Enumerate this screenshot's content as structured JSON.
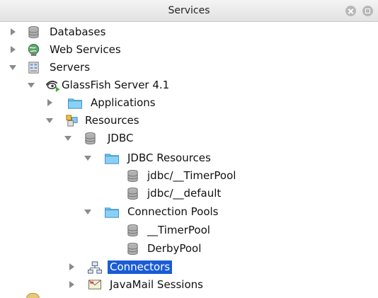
{
  "window": {
    "title": "Services"
  },
  "tree": [
    {
      "label": "Databases",
      "expanded": false,
      "icon": "database-icon"
    },
    {
      "label": "Web Services",
      "expanded": false,
      "icon": "web-services-icon"
    },
    {
      "label": "Servers",
      "expanded": true,
      "icon": "servers-icon"
    },
    {
      "label": "GlassFish Server 4.1",
      "expanded": true,
      "icon": "glassfish-server-icon"
    },
    {
      "label": "Applications",
      "expanded": false,
      "icon": "folder-icon"
    },
    {
      "label": "Resources",
      "expanded": true,
      "icon": "resources-icon"
    },
    {
      "label": "JDBC",
      "expanded": true,
      "icon": "database-icon"
    },
    {
      "label": "JDBC Resources",
      "expanded": true,
      "icon": "folder-icon"
    },
    {
      "label": "jdbc/__TimerPool",
      "icon": "jdbc-resource-icon"
    },
    {
      "label": "jdbc/__default",
      "icon": "jdbc-resource-icon"
    },
    {
      "label": "Connection Pools",
      "expanded": true,
      "icon": "folder-icon"
    },
    {
      "label": "__TimerPool",
      "icon": "connection-pool-icon"
    },
    {
      "label": "DerbyPool",
      "icon": "connection-pool-icon"
    },
    {
      "label": "Connectors",
      "expanded": false,
      "selected": true,
      "icon": "connectors-icon"
    },
    {
      "label": "JavaMail Sessions",
      "expanded": false,
      "icon": "javamail-icon"
    }
  ],
  "colors": {
    "selection": "#1a5cd6",
    "folder": "#6cc0f0",
    "database": "#9a9a9a"
  }
}
